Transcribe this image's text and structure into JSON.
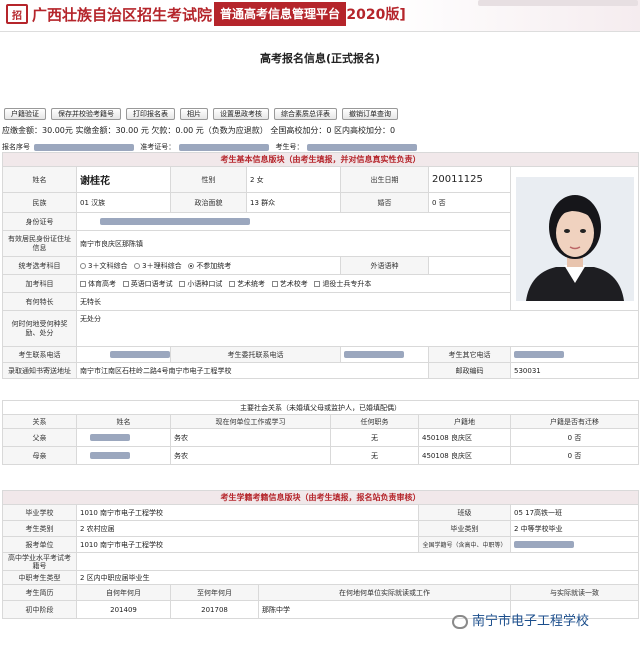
{
  "header": {
    "title": "广西壮族自治区招生考试院",
    "badge": "普通高考信息管理平台",
    "year": "[2020版]",
    "logo_text": "招"
  },
  "page_title": "高考报名信息(正式报名)",
  "toolbar": [
    "户籍验证",
    "保存并校验考籍号",
    "打印报名表",
    "相片",
    "设置思政考核",
    "综合素质总评表",
    "撤销订单查询"
  ],
  "fee_line": "应缴金额：30.00元 实缴金额：30.00 元 欠款：0.00 元（负数为应退款） 全国高校加分：0 区内高校加分：0",
  "ids": {
    "reg_label": "报名序号",
    "exam_id_label": "准考证号：",
    "ksh_label": "考生号："
  },
  "basic": {
    "section": "考生基本信息版块（由考生填报，并对信息真实性负责）",
    "name_label": "姓名",
    "name": "谢桂花",
    "gender_label": "性别",
    "gender": "2  女",
    "birth_label": "出生日期",
    "birth": "20011125",
    "nation_label": "民族",
    "nation": "01  汉族",
    "politics_label": "政治面貌",
    "politics": "13  群众",
    "marital_label": "婚否",
    "marital": "0  否",
    "idcard_label": "身份证号",
    "address_label": "有效居民身份证住址信息",
    "address": "南宁市良庆区那陈镇",
    "subject_label": "统考选考科目",
    "subjects": [
      "3＋文科综合",
      "3＋理科综合",
      "不参加统考"
    ],
    "foreign_label": "外语语种",
    "extra_label": "加考科目",
    "extras": [
      "体育高考",
      "英语口语考试",
      "小语种口试",
      "艺术统考",
      "艺术校考",
      "退役士兵专升本"
    ],
    "skill_label": "有何特长",
    "skill": "无特长",
    "reward_label": "何时何地受何种奖励、处分",
    "reward": "无处分",
    "phone_label": "考生联系电话",
    "guardian_phone_label": "考生委托联系电话",
    "other_phone_label": "考生其它电话",
    "mail_label": "录取通知书寄送地址",
    "mail": "南宁市江南区石柱岭二路4号南宁市电子工程学校",
    "zip_label": "邮政编码",
    "zip": "530031"
  },
  "family": {
    "title": "主要社会关系（未婚填父母或监护人，已婚填配偶）",
    "headers": [
      "关系",
      "姓名",
      "现在何单位工作或学习",
      "任何职务",
      "户籍地",
      "户籍是否有迁移"
    ],
    "rows": [
      {
        "rel": "父亲",
        "work": "务农",
        "post": "无",
        "hj": "450108  良庆区",
        "move": "0  否"
      },
      {
        "rel": "母亲",
        "work": "务农",
        "post": "无",
        "hj": "450108  良庆区",
        "move": "0  否"
      }
    ]
  },
  "study": {
    "section": "考生学籍考籍信息版块（由考生填报，报名站负责审核）",
    "school_label": "毕业学校",
    "school": "1010  南宁市电子工程学校",
    "class_label": "班级",
    "class": "05  17高铁一班",
    "type_label": "考生类别",
    "type": "2  农村应届",
    "grad_label": "毕业类别",
    "grad": "2  中等学校毕业",
    "unit_label": "报考单位",
    "unit": "1010  南宁市电子工程学校",
    "xjh_label": "全国学籍号（含高中、中职等）",
    "hs_label": "高中学业水平考试考籍号",
    "vs_label": "中职考生类型",
    "vs": "2  区内中职应届毕业生",
    "resume_headers": [
      "考生简历",
      "自何年何月",
      "至何年何月",
      "在何地何单位实际就读或工作",
      "与实际就读一致"
    ],
    "resume": [
      {
        "stage": "初中阶段",
        "from": "201409",
        "to": "201708",
        "place": "那陈中学"
      }
    ]
  },
  "watermark": "南宁市电子工程学校",
  "colors": {
    "brand": "#b5252b",
    "section_bg": "#f1e8ea"
  }
}
